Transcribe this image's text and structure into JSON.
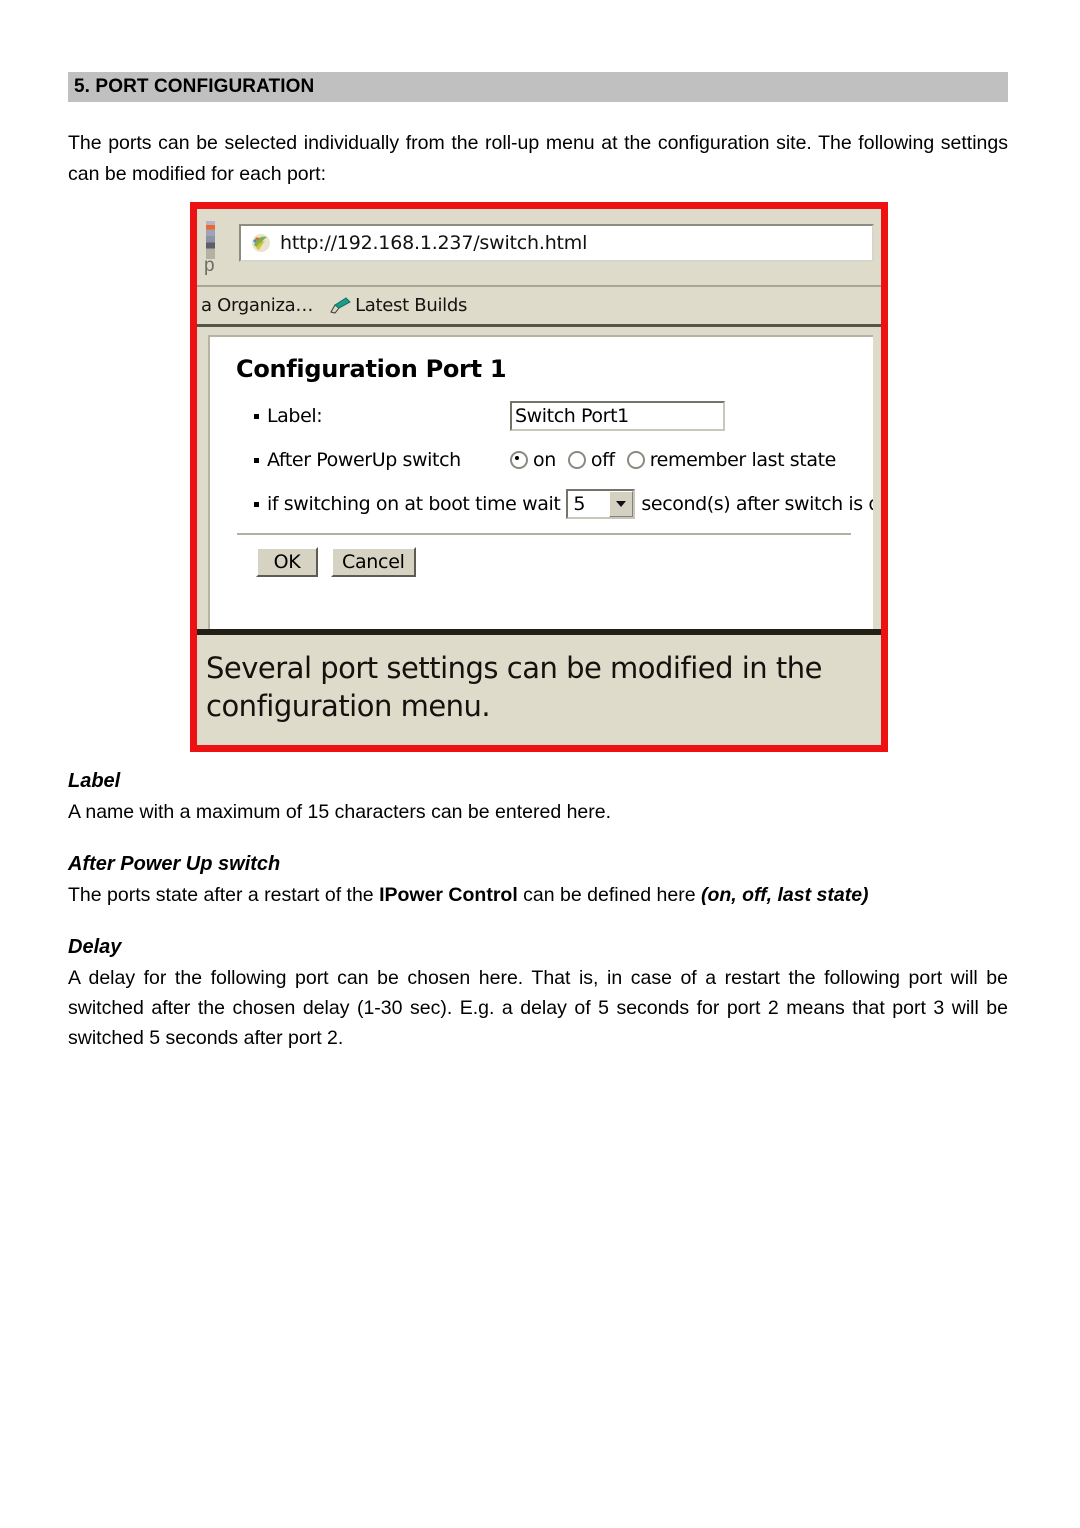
{
  "document": {
    "section_number_title": "5. PORT CONFIGURATION",
    "intro_paragraph": "The ports can be selected individually from the roll-up menu at the configuration site. The following settings can be modified for each port:"
  },
  "figure": {
    "border_color": "#ee1111",
    "browser": {
      "toolbar_letter": "p",
      "url_favicon_name": "firefox-favicon",
      "url": "http://192.168.1.237/switch.html",
      "bookmarks": [
        {
          "label": "a Organiza…",
          "icon": ""
        },
        {
          "label": "Latest Builds",
          "icon": "pencil-icon"
        }
      ]
    },
    "form": {
      "title": "Configuration Port 1",
      "label_row": {
        "label": "Label:",
        "input_value": "Switch Port1"
      },
      "powerup_row": {
        "label": "After PowerUp switch",
        "options": [
          {
            "label": "on",
            "selected": true
          },
          {
            "label": "off",
            "selected": false
          },
          {
            "label": "remember last state",
            "selected": false
          }
        ]
      },
      "delay_row": {
        "prefix": "if switching on at boot time wait",
        "select_value": "5",
        "suffix": "second(s) after switch is on"
      },
      "buttons": {
        "ok": "OK",
        "cancel": "Cancel"
      }
    },
    "caption_line1": "Several port settings can be modified in the",
    "caption_line2": "configuration menu."
  },
  "sections": [
    {
      "heading": "Label",
      "paragraph": "A name with a maximum of 15 characters can be entered here."
    },
    {
      "heading": "After Power Up switch",
      "paragraph_part1": "The ports state after a restart of the ",
      "paragraph_bold": "IPower Control",
      "paragraph_part2": " can be defined here ",
      "paragraph_bold_italic": "(on, off, last state)"
    },
    {
      "heading": "Delay",
      "paragraph": "A delay for the following port can be chosen here. That is, in case of a restart the following port will be switched after the chosen delay (1-30 sec). E.g. a delay of 5 seconds for port 2 means that port 3 will be switched 5 seconds after port 2."
    }
  ]
}
